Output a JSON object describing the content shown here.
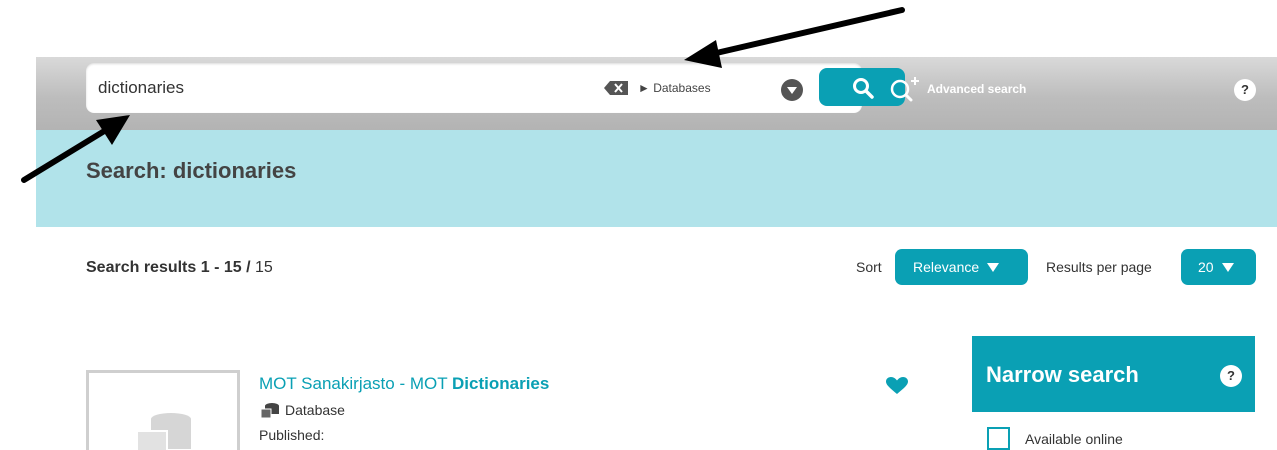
{
  "search": {
    "value": "dictionaries",
    "scope_label": "► Databases",
    "clear_icon": "backspace-clear-icon",
    "search_icon": "magnifier-icon"
  },
  "toolbar": {
    "advanced_search_label": "Advanced search",
    "help_label": "?"
  },
  "hero": {
    "title": "Search: dictionaries"
  },
  "results": {
    "summary_prefix": "Search results 1 - 15 /",
    "summary_total": "15",
    "sort_label": "Sort",
    "sort_value": "Relevance",
    "per_page_label": "Results per page",
    "per_page_value": "20"
  },
  "record": {
    "title_plain": "MOT Sanakirjasto - MOT ",
    "title_highlight": "Dictionaries",
    "format": "Database",
    "published_label": "Published:"
  },
  "sidebar": {
    "title": "Narrow search",
    "help_label": "?",
    "facets": [
      {
        "label": "Available online",
        "checked": false
      }
    ]
  },
  "colors": {
    "accent": "#0aa0b4",
    "hero_bg": "#b1e3ea",
    "bar_gray": "#bdbdbd"
  }
}
